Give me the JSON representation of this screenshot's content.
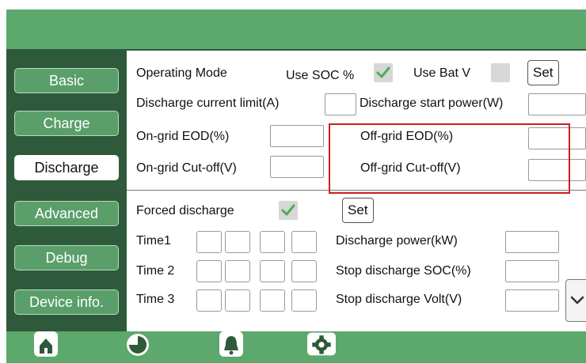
{
  "sidebar": {
    "items": [
      {
        "label": "Basic"
      },
      {
        "label": "Charge"
      },
      {
        "label": "Discharge"
      },
      {
        "label": "Advanced"
      },
      {
        "label": "Debug"
      },
      {
        "label": "Device info."
      }
    ],
    "active": "Discharge"
  },
  "discharge": {
    "operating_mode_label": "Operating Mode",
    "use_soc_label": "Use SOC %",
    "use_soc_checked": true,
    "use_bat_v_label": "Use Bat V",
    "use_bat_v_checked": false,
    "set_label": "Set",
    "discharge_current_limit_label": "Discharge current limit(A)",
    "discharge_start_power_label": "Discharge start power(W)",
    "on_grid_eod_label": "On-grid EOD(%)",
    "off_grid_eod_label": "Off-grid EOD(%)",
    "on_grid_cutoff_label": "On-grid Cut-off(V)",
    "off_grid_cutoff_label": "Off-grid Cut-off(V)"
  },
  "forced": {
    "forced_discharge_label": "Forced discharge",
    "forced_discharge_checked": true,
    "set_label": "Set",
    "time1_label": "Time1",
    "time2_label": "Time 2",
    "time3_label": "Time 3",
    "discharge_power_label": "Discharge power(kW)",
    "stop_soc_label": "Stop discharge SOC(%)",
    "stop_volt_label": "Stop discharge Volt(V)"
  },
  "nav": {
    "icons": [
      "home-icon",
      "pie-chart-icon",
      "bell-icon",
      "gear-icon"
    ],
    "active": "gear-icon"
  },
  "colors": {
    "header_green": "#5da86c",
    "sidebar_dark": "#2e5a3b",
    "button_green": "#5a9f6a",
    "highlight_red": "#d01c1c",
    "check_green": "#4caf50"
  }
}
